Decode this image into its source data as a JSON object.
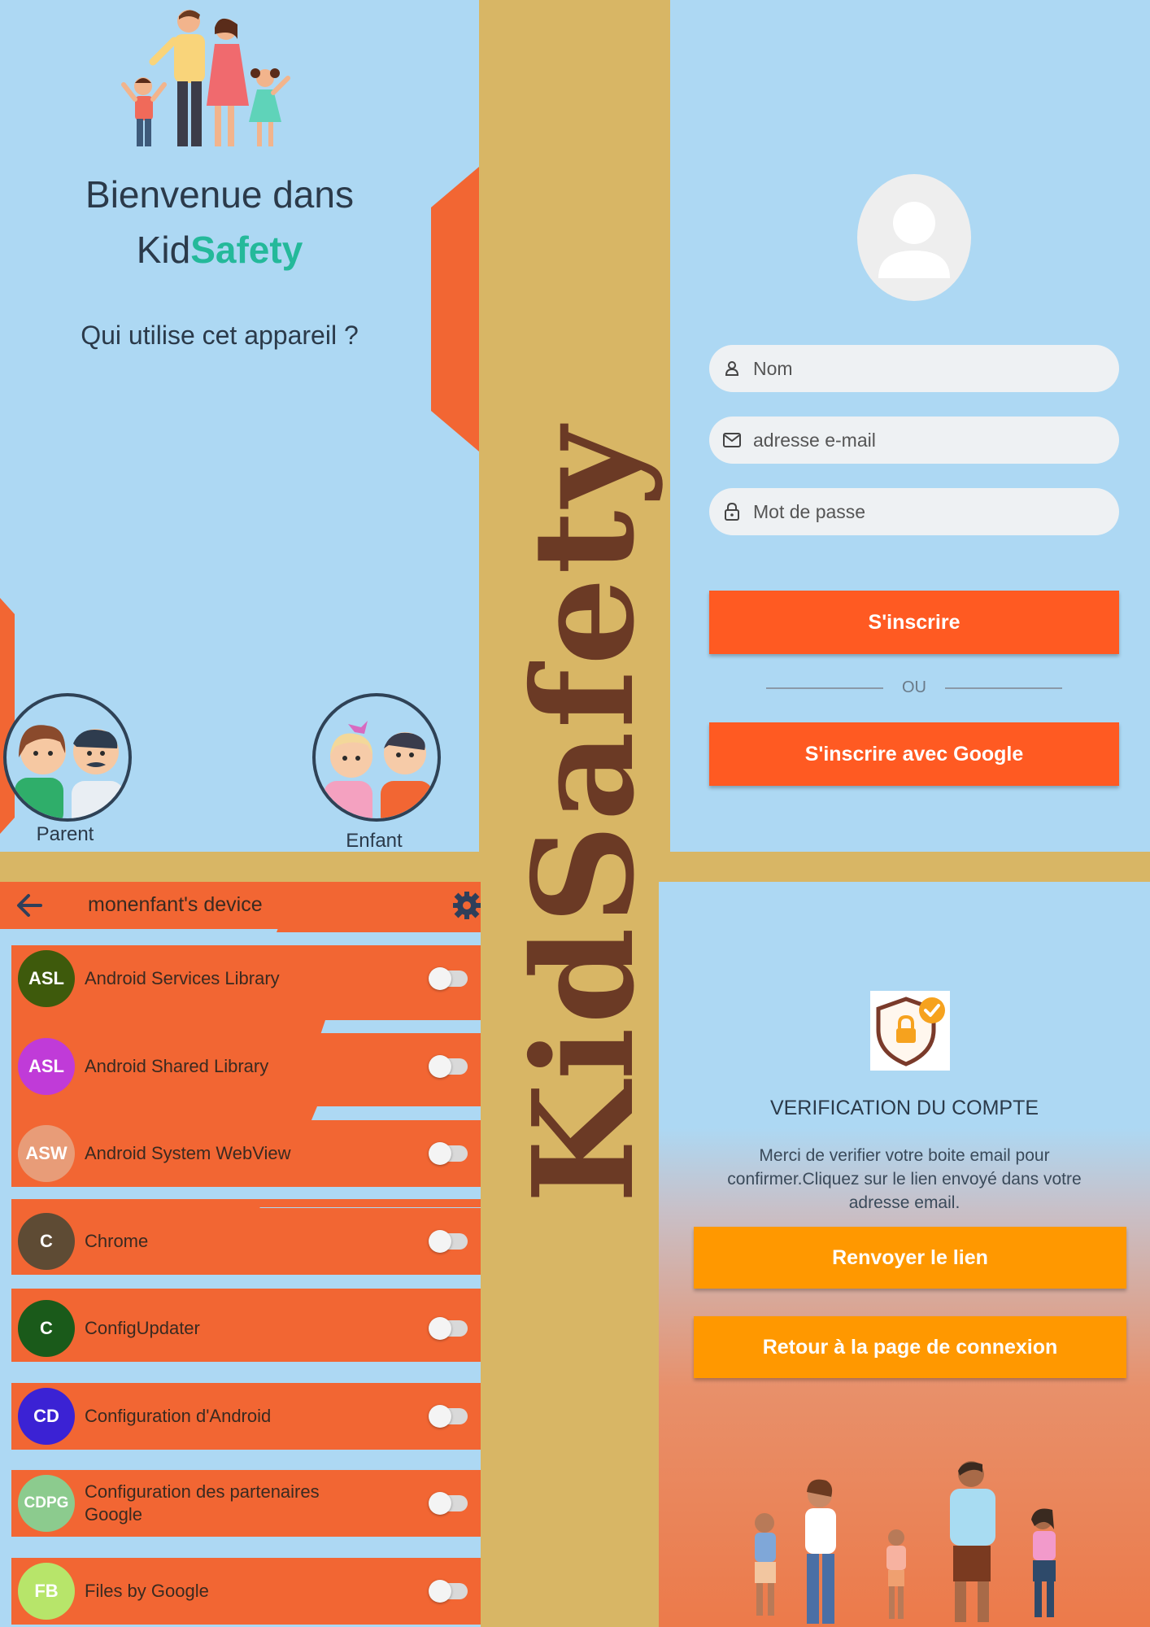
{
  "brand": {
    "name": "KidSafety",
    "color": "#6B3A25"
  },
  "welcome_screen": {
    "title_line1": "Bienvenue dans",
    "brand_part1": "Kid",
    "brand_part2": "Safety",
    "question": "Qui utilise cet appareil ?",
    "roles": [
      {
        "label": "Parent",
        "icon": "parents-avatar-icon"
      },
      {
        "label": "Enfant",
        "icon": "kids-avatar-icon"
      }
    ],
    "colors": {
      "background": "#ADD8F3",
      "accent": "#24B99A",
      "shape": "#F26633"
    }
  },
  "signup_screen": {
    "avatar_icon": "user-placeholder-icon",
    "fields": [
      {
        "placeholder": "Nom",
        "icon": "person-icon"
      },
      {
        "placeholder": "adresse e-mail",
        "icon": "mail-icon"
      },
      {
        "placeholder": "Mot de passe",
        "icon": "lock-icon"
      }
    ],
    "register_label": "S'inscrire",
    "divider_label": "OU",
    "google_label": "S'inscrire avec Google",
    "colors": {
      "button": "#FF5A22"
    }
  },
  "apps_screen": {
    "title": "monenfant's device",
    "back_icon": "arrow-left-icon",
    "settings_icon": "gear-icon",
    "apps": [
      {
        "initials": "ASL",
        "name": "Android Services Library",
        "color": "#3E5A0C",
        "enabled": false
      },
      {
        "initials": "ASL",
        "name": "Android Shared Library",
        "color": "#C03BD8",
        "enabled": false
      },
      {
        "initials": "ASW",
        "name": "Android System WebView",
        "color": "#E89C78",
        "enabled": false
      },
      {
        "initials": "C",
        "name": "Chrome",
        "color": "#5E4B34",
        "enabled": false
      },
      {
        "initials": "C",
        "name": "ConfigUpdater",
        "color": "#1A5A1A",
        "enabled": false
      },
      {
        "initials": "CD",
        "name": "Configuration d'Android",
        "color": "#3B22D4",
        "enabled": false
      },
      {
        "initials": "CDPG",
        "name": "Configuration des partenaires Google",
        "color": "#8CCB8E",
        "enabled": false
      },
      {
        "initials": "FB",
        "name": "Files by Google",
        "color": "#B7E56A",
        "enabled": false
      }
    ],
    "colors": {
      "bar": "#F26633"
    }
  },
  "verify_screen": {
    "shield_icon": "shield-lock-check-icon",
    "title": "VERIFICATION DU COMPTE",
    "message": "Merci de verifier votre boite email pour confirmer.Cliquez sur le lien envoyé dans votre adresse email.",
    "resend_label": "Renvoyer le lien",
    "back_label": "Retour à la page de connexion",
    "illustration": "family-running-illustration",
    "colors": {
      "button": "#FF9800"
    }
  }
}
